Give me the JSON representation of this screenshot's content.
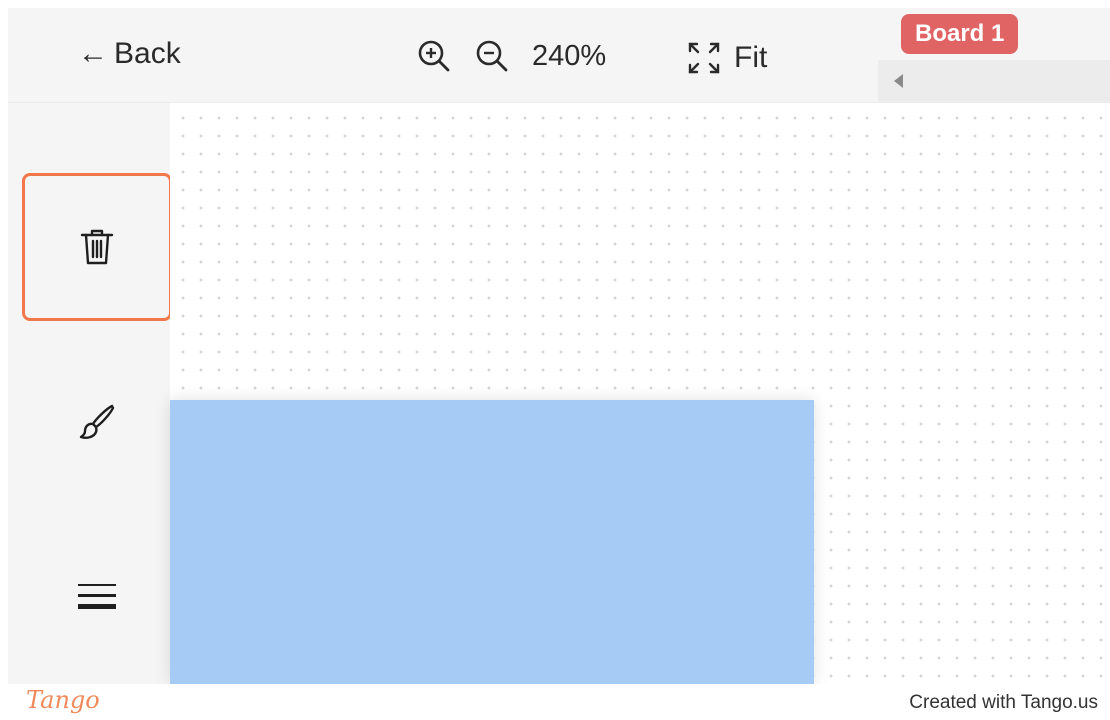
{
  "toolbar": {
    "back_label": "Back",
    "zoom_level": "240%",
    "fit_label": "Fit",
    "board_label": "Board 1",
    "board_color": "#e06464"
  },
  "sidebar": {
    "tools": [
      {
        "name": "trash-icon",
        "active": true
      },
      {
        "name": "paintbrush-icon",
        "active": false
      },
      {
        "name": "stroke-width-icon",
        "active": false
      }
    ],
    "active_border_color": "#f2784b"
  },
  "canvas": {
    "shape_color": "#a6cbf5",
    "grid": "dotted"
  },
  "footer": {
    "logo": "Tango",
    "credit": "Created with Tango.us"
  }
}
